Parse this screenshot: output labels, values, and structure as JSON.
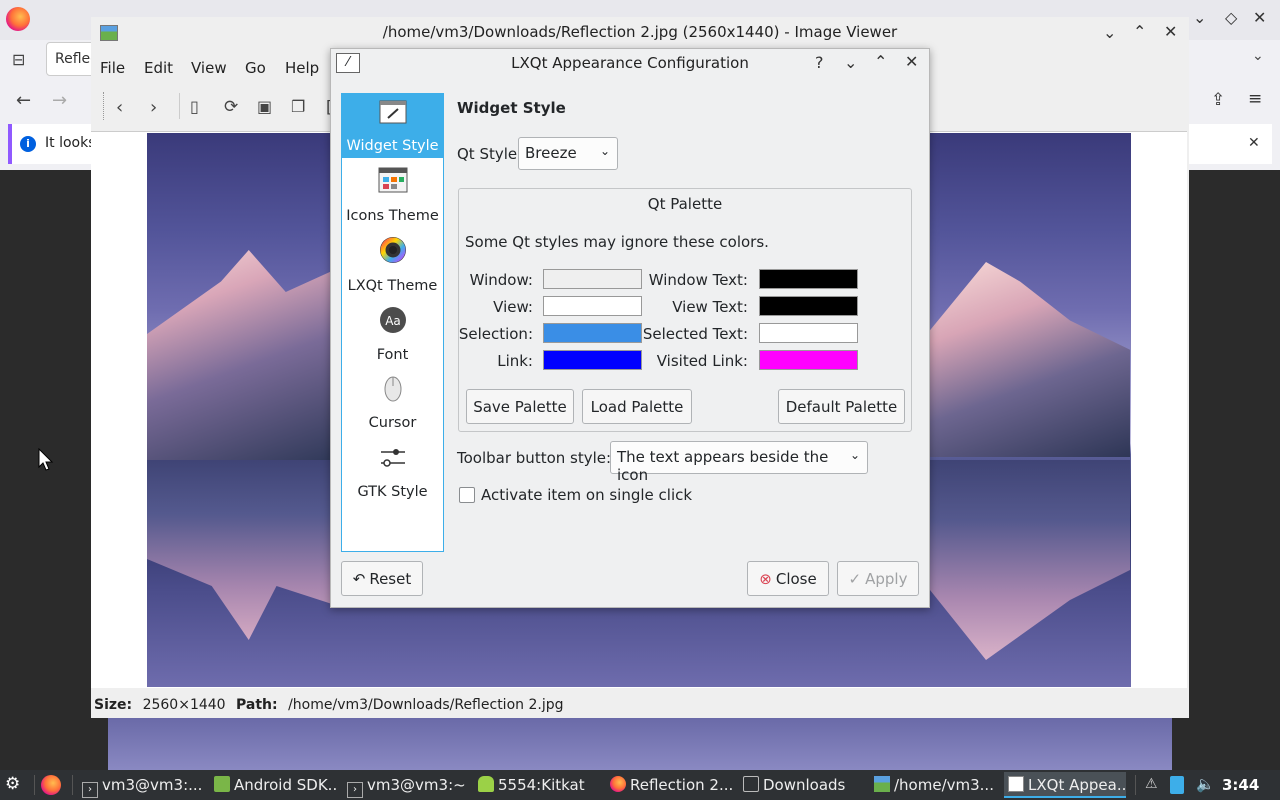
{
  "firefox": {
    "tab_label": "Reflec",
    "notice_text": "It looks"
  },
  "image_viewer": {
    "title": "/home/vm3/Downloads/Reflection 2.jpg (2560x1440) - Image Viewer",
    "menu": [
      "File",
      "Edit",
      "View",
      "Go",
      "Help"
    ],
    "status": {
      "size_label": "Size:",
      "size_value": "2560×1440",
      "path_label": "Path:",
      "path_value": "/home/vm3/Downloads/Reflection 2.jpg"
    }
  },
  "dialog": {
    "title": "LXQt Appearance Configuration",
    "sidebar": [
      {
        "label": "Widget Style",
        "icon": "widget-style-icon",
        "selected": true
      },
      {
        "label": "Icons Theme",
        "icon": "icons-theme-icon"
      },
      {
        "label": "LXQt Theme",
        "icon": "lxqt-theme-icon"
      },
      {
        "label": "Font",
        "icon": "font-icon"
      },
      {
        "label": "Cursor",
        "icon": "cursor-icon"
      },
      {
        "label": "GTK Style",
        "icon": "gtk-style-icon"
      }
    ],
    "section_title": "Widget Style",
    "qt_style_label": "Qt Style",
    "qt_style_value": "Breeze",
    "palette": {
      "title": "Qt Palette",
      "note": "Some Qt styles may ignore these colors.",
      "window_label": "Window:",
      "window_color": "#efefef",
      "window_text_label": "Window Text:",
      "window_text_color": "#000000",
      "view_label": "View:",
      "view_color": "#ffffff",
      "view_text_label": "View Text:",
      "view_text_color": "#000000",
      "selection_label": "Selection:",
      "selection_color": "#3a8ee6",
      "selected_text_label": "Selected Text:",
      "selected_text_color": "#ffffff",
      "link_label": "Link:",
      "link_color": "#0000ff",
      "visited_link_label": "Visited Link:",
      "visited_link_color": "#ff00ff",
      "save_button": "Save Palette",
      "load_button": "Load Palette",
      "default_button": "Default Palette"
    },
    "toolbar_style_label": "Toolbar button style:",
    "toolbar_style_value": "The text appears beside the icon",
    "single_click_label": "Activate item on single click",
    "single_click_checked": false,
    "reset_button": "Reset",
    "close_button": "Close",
    "apply_button": "Apply"
  },
  "taskbar": {
    "items": [
      {
        "label": "vm3@vm3:...",
        "icon": "terminal-icon"
      },
      {
        "label": "Android SDK...",
        "icon": "android-sdk-icon"
      },
      {
        "label": "vm3@vm3:~",
        "icon": "terminal-icon"
      },
      {
        "label": "5554:Kitkat",
        "icon": "android-emulator-icon"
      },
      {
        "label": "Reflection 2...",
        "icon": "firefox-icon"
      },
      {
        "label": "Downloads",
        "icon": "folder-icon"
      },
      {
        "label": "/home/vm3...",
        "icon": "image-viewer-icon"
      },
      {
        "label": "LXQt Appea...",
        "icon": "appearance-icon",
        "active": true
      }
    ],
    "clock": "3:44"
  }
}
